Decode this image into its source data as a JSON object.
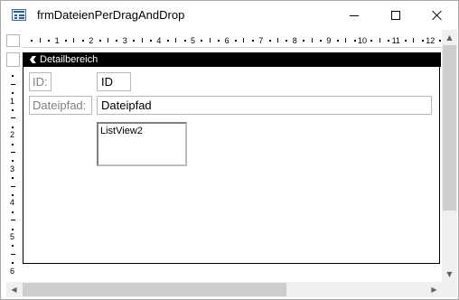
{
  "window": {
    "title": "frmDateienPerDragAndDrop",
    "icon": "form-icon",
    "min_glyph": "",
    "max_glyph": "",
    "close_glyph": ""
  },
  "ruler": {
    "h_numbers": [
      "1",
      "2",
      "3",
      "4",
      "5",
      "6",
      "7",
      "8",
      "9",
      "10",
      "11",
      "12"
    ],
    "v_numbers": [
      "1",
      "2",
      "3",
      "4",
      "5",
      "6"
    ]
  },
  "section": {
    "label": "Detailbereich",
    "icon": "arrow-icon"
  },
  "fields": {
    "id_label": "ID:",
    "id_value": "ID",
    "path_label": "Dateipfad:",
    "path_value": "Dateipfad",
    "listview": "ListView2"
  },
  "scroll": {
    "up": "▲",
    "down": "▼",
    "left": "◀",
    "right": "▶"
  },
  "colors": {
    "section_bar": "#000000",
    "label_text": "#808080"
  }
}
